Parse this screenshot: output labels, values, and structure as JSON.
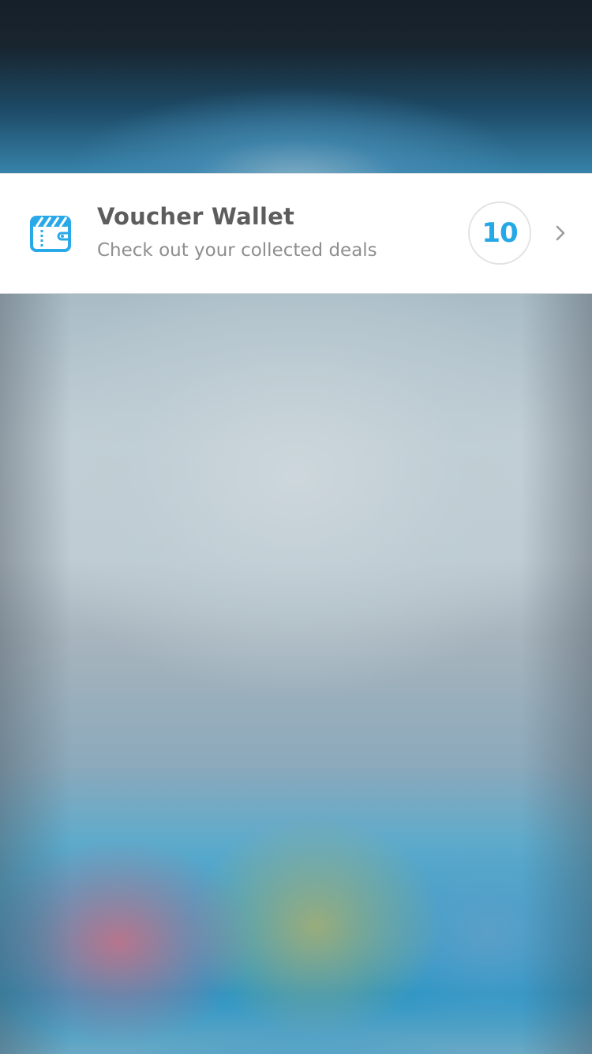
{
  "background": {
    "description_colors": {
      "top": "#16202a",
      "accent_blue": "#2a95c5",
      "pink": "#cd6e82",
      "olive": "#aaaf6e"
    }
  },
  "voucher_card": {
    "icon": "wallet-icon",
    "title": "Voucher Wallet",
    "subtitle": "Check out your collected deals",
    "count": "10",
    "chevron_icon": "chevron-right-icon",
    "accent_color": "#27a8e6"
  }
}
